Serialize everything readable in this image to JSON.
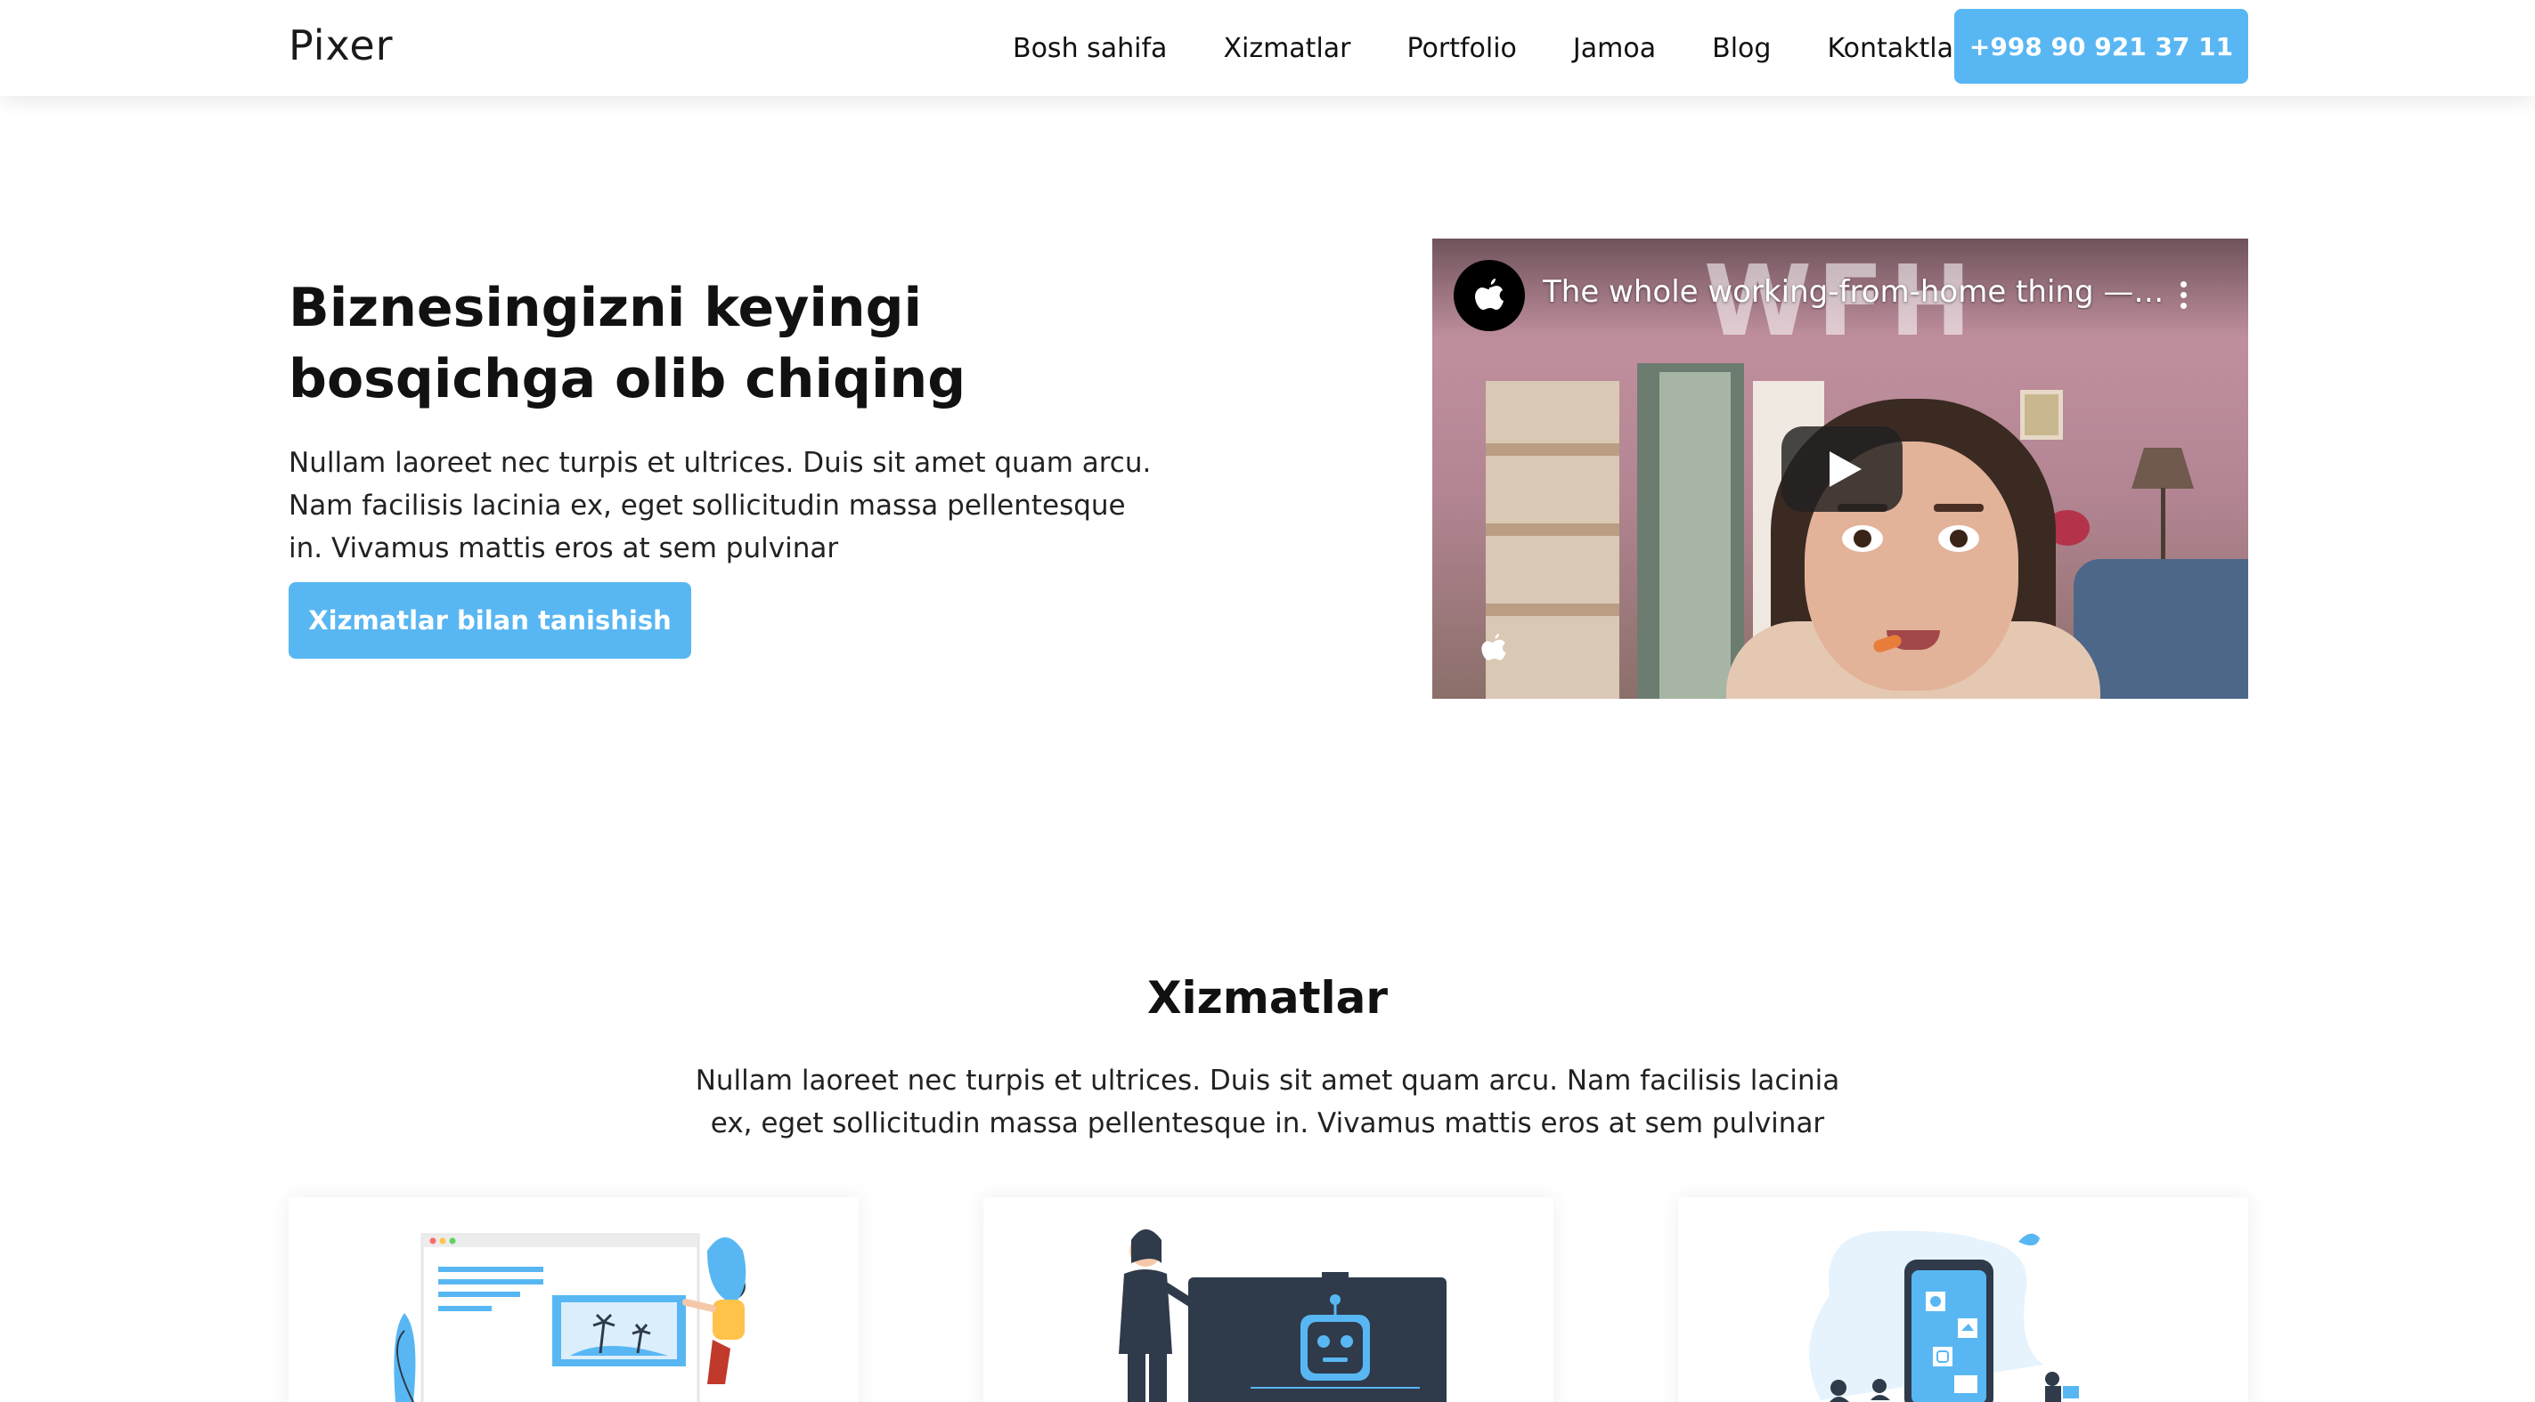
{
  "header": {
    "logo": "Pixer",
    "nav": [
      "Bosh sahifa",
      "Xizmatlar",
      "Portfolio",
      "Jamoa",
      "Blog",
      "Kontaktlar"
    ],
    "phone": "+998 90 921 37 11"
  },
  "hero": {
    "title": "Biznesingizni keyingi bosqichga olib chiqing",
    "text": "Nullam laoreet nec turpis et ultrices. Duis sit amet quam arcu. Nam facilisis lacinia ex, eget sollicitudin massa pellentesque in. Vivamus mattis eros at sem pulvinar",
    "button": "Xizmatlar bilan tanishish"
  },
  "video": {
    "title": "The whole working-from-home thing — A…",
    "overlay_text": "WFH",
    "channel_icon": "apple-logo-icon",
    "watermark_icon": "apple-logo-icon",
    "play_icon": "play-icon",
    "menu_icon": "more-vertical-icon"
  },
  "services": {
    "title": "Xizmatlar",
    "text": "Nullam laoreet nec turpis et ultrices. Duis sit amet quam arcu. Nam facilisis lacinia ex, eget sollicitudin massa pellentesque in. Vivamus mattis eros at sem pulvinar",
    "cards": [
      {
        "illustration": "web-design-illustration"
      },
      {
        "illustration": "ai-robot-illustration"
      },
      {
        "illustration": "mobile-app-illustration"
      }
    ]
  },
  "colors": {
    "accent": "#58b7f3",
    "text": "#111111",
    "header_bg": "#ffffff"
  }
}
